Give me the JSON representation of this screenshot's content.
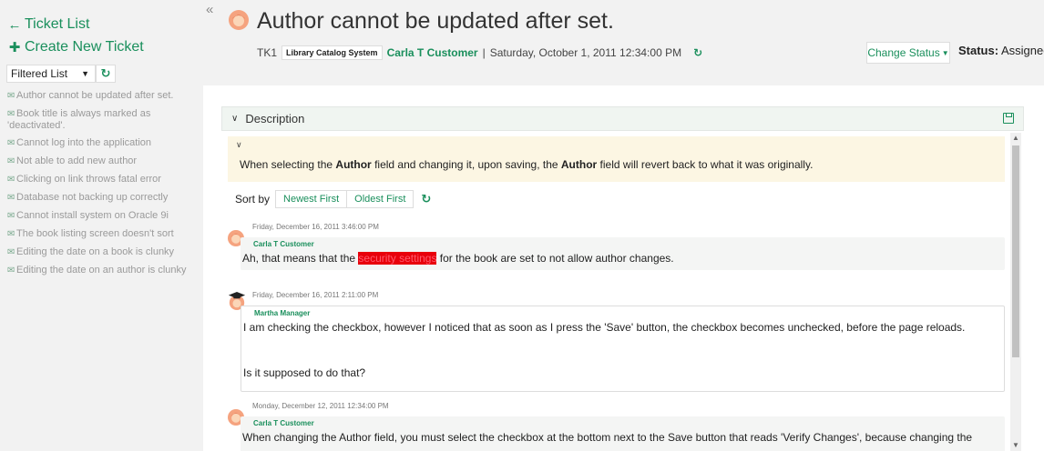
{
  "sidebar": {
    "ticket_list_label": "Ticket List",
    "create_ticket_label": "Create New Ticket",
    "filter_selected": "Filtered List",
    "tickets": [
      "Author cannot be updated after set.",
      "Book title is always marked as 'deactivated'.",
      "Cannot log into the application",
      "Not able to add new author",
      "Clicking on link throws fatal error",
      "Database not backing up correctly",
      "Cannot install system on Oracle 9i",
      "The book listing screen doesn't sort",
      "Editing the date on a book is clunky",
      "Editing the date on an author is clunky"
    ]
  },
  "header": {
    "collapse_glyph": "«",
    "title": "Author cannot be updated after set.",
    "ticket_id": "TK1",
    "project": "Library Catalog System",
    "author": "Carla T Customer",
    "separator": "|",
    "date": "Saturday, October 1, 2011 12:34:00 PM",
    "change_status_label": "Change Status",
    "status_label": "Status:",
    "status_value": "Assigned"
  },
  "description": {
    "section_label": "Description",
    "text_part1": "When selecting the ",
    "bold1": "Author",
    "text_part2": " field and changing it, upon saving, the ",
    "bold2": "Author",
    "text_part3": " field will revert back to what it was originally."
  },
  "sort": {
    "label": "Sort by",
    "newest": "Newest First",
    "oldest": "Oldest First"
  },
  "comments": [
    {
      "date": "Friday, December 16, 2011 3:46:00 PM",
      "author": "Carla T Customer",
      "text_before": "Ah, that means that the ",
      "highlight": "security settings",
      "text_after": " for the book are set to not allow author changes."
    },
    {
      "date": "Friday, December 16, 2011 2:11:00 PM",
      "author": "Martha Manager",
      "text": "I am checking the checkbox, however I noticed that as soon as I press the 'Save' button, the checkbox becomes unchecked, before the page reloads.",
      "text2": "Is it supposed to do that?"
    },
    {
      "date": "Monday, December 12, 2011 12:34:00 PM",
      "author": "Carla T Customer",
      "text": "When changing the Author field, you must select the checkbox at the bottom next to the Save button that reads 'Verify Changes', because changing the"
    }
  ],
  "colors": {
    "accent": "#1a8f5c",
    "description_bg": "#fcf6e3",
    "highlight": "#e8000b"
  },
  "icons": {
    "ticket_list": "arrow-left-icon",
    "create": "plus-icon",
    "refresh": "refresh-icon",
    "ticket": "envelope-icon",
    "save": "floppy-disk-icon",
    "avatar": "user-avatar-icon"
  }
}
